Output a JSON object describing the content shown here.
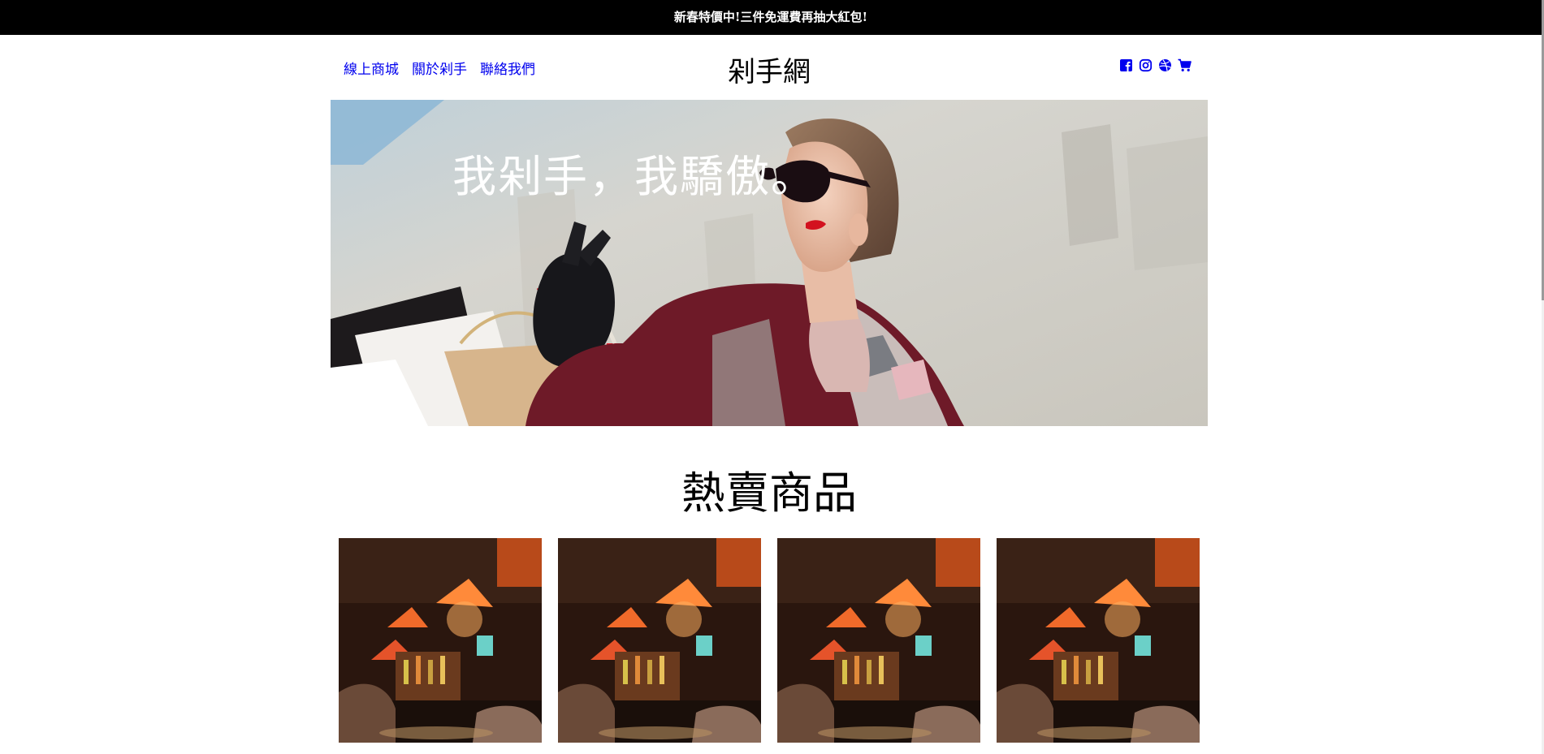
{
  "promo": {
    "text": "新春特價中!三件免運費再抽大紅包!"
  },
  "header": {
    "title": "剁手網",
    "nav": [
      {
        "label": "線上商城"
      },
      {
        "label": "關於剁手"
      },
      {
        "label": "聯絡我們"
      }
    ],
    "icons": [
      "facebook-icon",
      "instagram-icon",
      "dribbble-icon",
      "cart-icon"
    ]
  },
  "hero": {
    "slogan": "我剁手，我驕傲。"
  },
  "section": {
    "title": "熱賣商品"
  },
  "products": [
    {
      "name": "product-1"
    },
    {
      "name": "product-2"
    },
    {
      "name": "product-3"
    },
    {
      "name": "product-4"
    }
  ],
  "colors": {
    "promo_bg": "#000000",
    "link": "#0000ee",
    "icon": "#0000ee"
  }
}
